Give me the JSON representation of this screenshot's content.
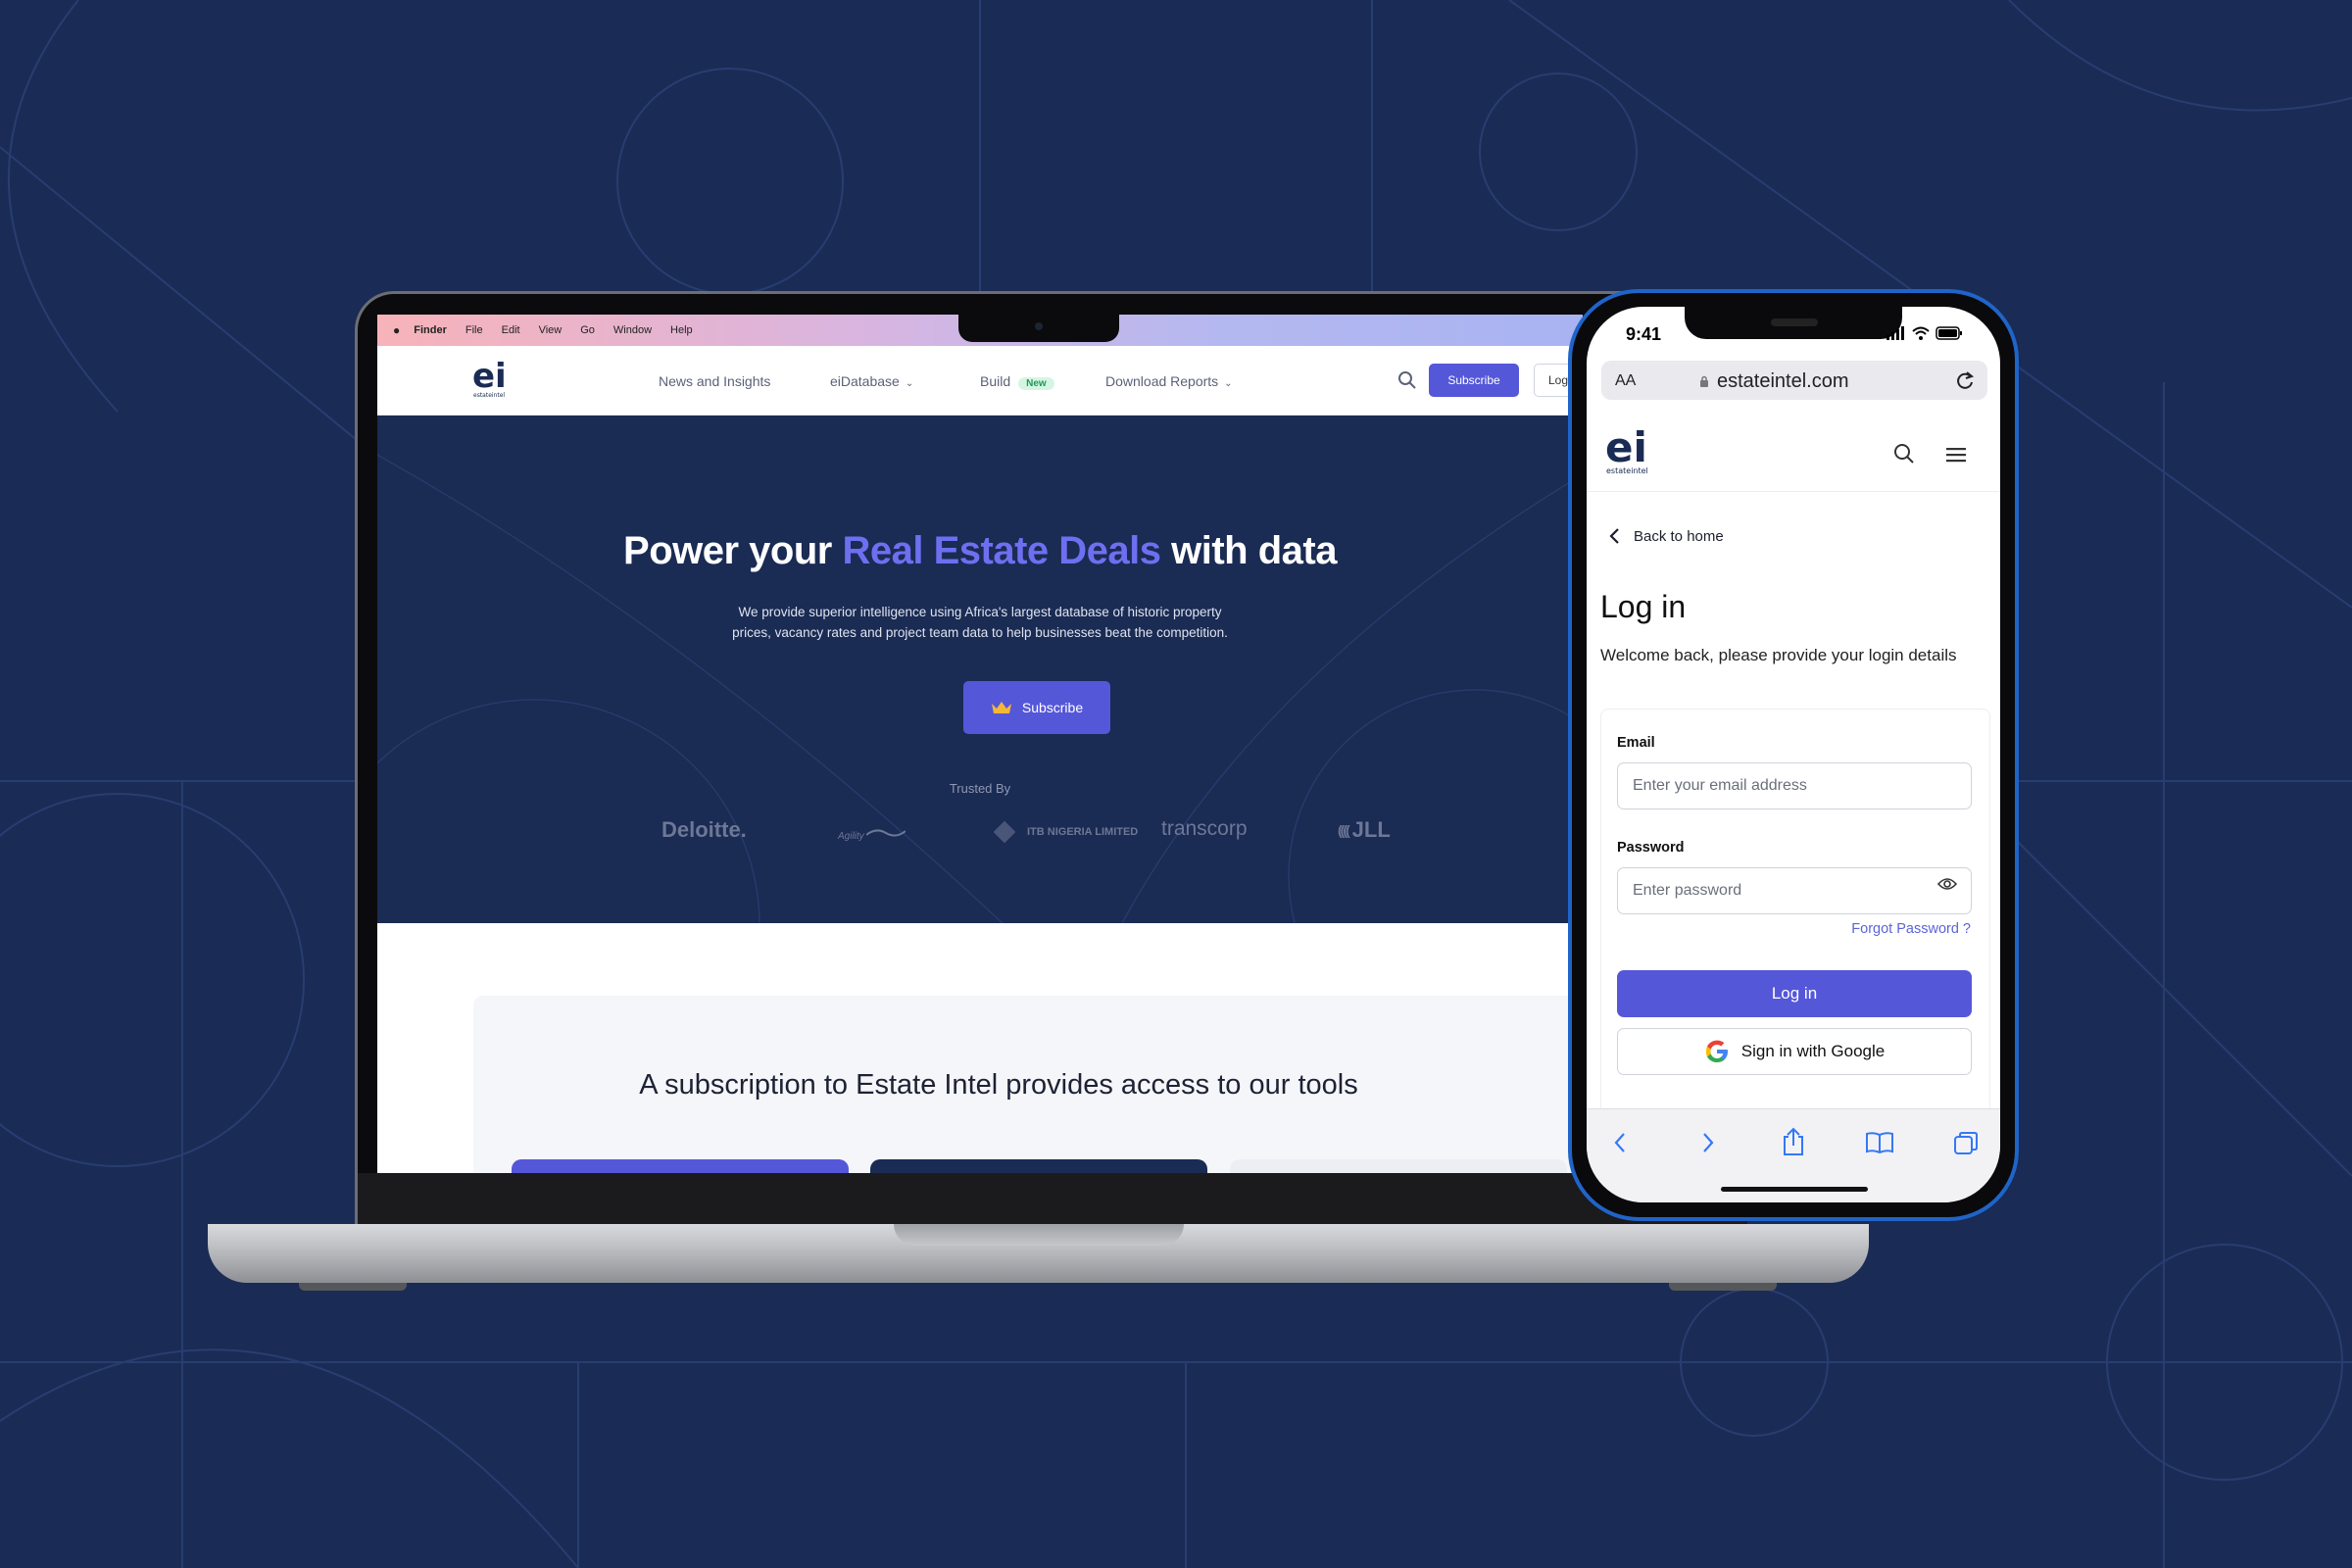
{
  "mac_menubar": {
    "apple_icon": "apple-icon",
    "items": [
      "Finder",
      "File",
      "Edit",
      "View",
      "Go",
      "Window",
      "Help"
    ]
  },
  "desktop_site": {
    "logo": {
      "mark": "ei",
      "wordmark": "estateintel"
    },
    "nav": {
      "news": "News and Insights",
      "database": "eiDatabase",
      "build": "Build",
      "build_badge": "New",
      "reports": "Download Reports"
    },
    "subscribe_label": "Subscribe",
    "login_label": "Log",
    "hero": {
      "title_before": "Power your ",
      "title_accent": "Real Estate Deals",
      "title_after": " with data",
      "subtitle": "We provide superior intelligence using Africa's largest database of historic property prices, vacancy rates and project team data to help businesses beat the competition.",
      "cta_label": "Subscribe",
      "trusted_by": "Trusted By",
      "brands": [
        "Deloitte.",
        "Agility",
        "ITB NIGERIA LIMITED",
        "transcorp",
        "JLL"
      ]
    },
    "tools_title": "A subscription to Estate Intel provides access to our tools"
  },
  "phone": {
    "status_time": "9:41",
    "url_aa": "AA",
    "url": "estateintel.com",
    "logo": {
      "mark": "ei",
      "wordmark": "estateintel"
    },
    "back_label": "Back to home",
    "login_title": "Log in",
    "login_subtitle": "Welcome back, please provide your login details",
    "email_label": "Email",
    "email_placeholder": "Enter your email address",
    "password_label": "Password",
    "password_placeholder": "Enter password",
    "forgot_label": "Forgot Password ?",
    "login_button": "Log in",
    "google_button": "Sign in with Google"
  },
  "colors": {
    "background": "#1a2b55",
    "hero": "#1a2b54",
    "accent": "#5557d9",
    "accent_text": "#6e6ff0",
    "phone_frame": "#1f64c8"
  }
}
